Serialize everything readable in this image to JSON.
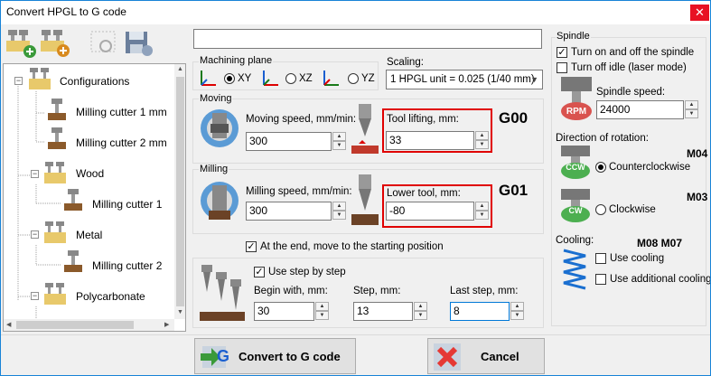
{
  "window": {
    "title": "Convert HPGL to G code",
    "close_glyph": "✕"
  },
  "tree": {
    "items": [
      {
        "label": "Configurations"
      },
      {
        "label": "Milling cutter 1 mm"
      },
      {
        "label": "Milling cutter 2 mm"
      },
      {
        "label": "Wood"
      },
      {
        "label": "Milling cutter 1"
      },
      {
        "label": "Metal"
      },
      {
        "label": "Milling cutter 2"
      },
      {
        "label": "Polycarbonate"
      }
    ]
  },
  "top_input": {
    "value": ""
  },
  "machining_plane": {
    "label": "Machining plane",
    "options": [
      "XY",
      "XZ",
      "YZ"
    ],
    "selected": "XY"
  },
  "scaling": {
    "label": "Scaling:",
    "value": "1 HPGL unit = 0.025 (1/40 mm)"
  },
  "moving": {
    "label": "Moving",
    "speed_label": "Moving speed, mm/min:",
    "speed_value": "300",
    "lift_label": "Tool lifting, mm:",
    "lift_value": "33",
    "gcode": "G00"
  },
  "milling": {
    "label": "Milling",
    "speed_label": "Milling speed, mm/min:",
    "speed_value": "300",
    "lower_label": "Lower tool, mm:",
    "lower_value": "-80",
    "gcode": "G01"
  },
  "end_move": {
    "label": "At the end, move to the starting position",
    "checked": true
  },
  "step": {
    "use_label": "Use step by step",
    "checked": true,
    "begin_label": "Begin with, mm:",
    "begin_value": "30",
    "step_label": "Step, mm:",
    "step_value": "13",
    "last_label": "Last step, mm:",
    "last_value": "8"
  },
  "spindle": {
    "label": "Spindle",
    "turn_on_off": "Turn on and off the spindle",
    "turn_on_checked": true,
    "turn_off_idle": "Turn off idle (laser mode)",
    "speed_label": "Spindle speed:",
    "speed_value": "24000",
    "rpm_icon_text": "RPM"
  },
  "rotation": {
    "label": "Direction of rotation:",
    "ccw_code": "M04",
    "ccw_label": "Counterclockwise",
    "ccw_icon_text": "CCW",
    "cw_code": "M03",
    "cw_label": "Clockwise",
    "cw_icon_text": "CW",
    "selected": "Counterclockwise"
  },
  "cooling": {
    "label": "Cooling:",
    "codes": "M08 M07",
    "use_cooling": "Use cooling",
    "use_additional": "Use additional cooling"
  },
  "buttons": {
    "convert": "Convert to G code",
    "cancel": "Cancel",
    "convert_icon_letter": "G"
  },
  "colors": {
    "accent": "#1883d7",
    "highlight": "#e00000",
    "close": "#e81123"
  }
}
